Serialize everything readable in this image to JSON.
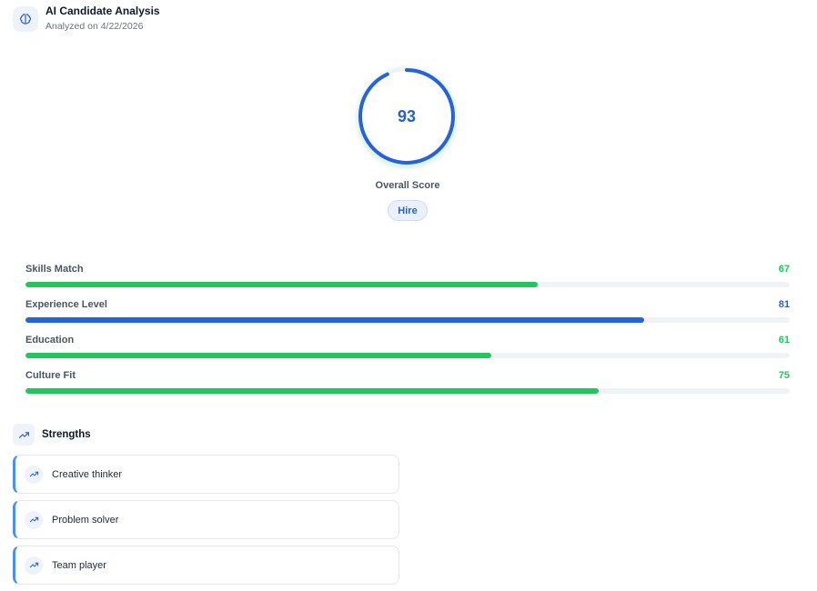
{
  "header": {
    "title": "AI Candidate Analysis",
    "subtitle": "Analyzed on 4/22/2026",
    "icon": "brain-icon"
  },
  "score": {
    "value": 93,
    "fraction": 0.93,
    "label": "Overall Score",
    "recommendation": "Hire",
    "ring_color": "#2563dc",
    "glow_color": "#bfeccf"
  },
  "metrics": [
    {
      "name": "Skills Match",
      "value": 67,
      "display": "67",
      "color": "#22c55e"
    },
    {
      "name": "Experience Level",
      "value": 81,
      "display": "81",
      "color": "#2563dc"
    },
    {
      "name": "Education",
      "value": 61,
      "display": "61",
      "color": "#22c55e"
    },
    {
      "name": "Culture Fit",
      "value": 75,
      "display": "75",
      "color": "#22c55e"
    }
  ],
  "strengths": {
    "title": "Strengths",
    "icon": "trending-up-icon",
    "items": [
      {
        "label": "Creative thinker",
        "icon": "trending-up-icon"
      },
      {
        "label": "Problem solver",
        "icon": "trending-up-icon"
      },
      {
        "label": "Team player",
        "icon": "trending-up-icon"
      }
    ]
  }
}
